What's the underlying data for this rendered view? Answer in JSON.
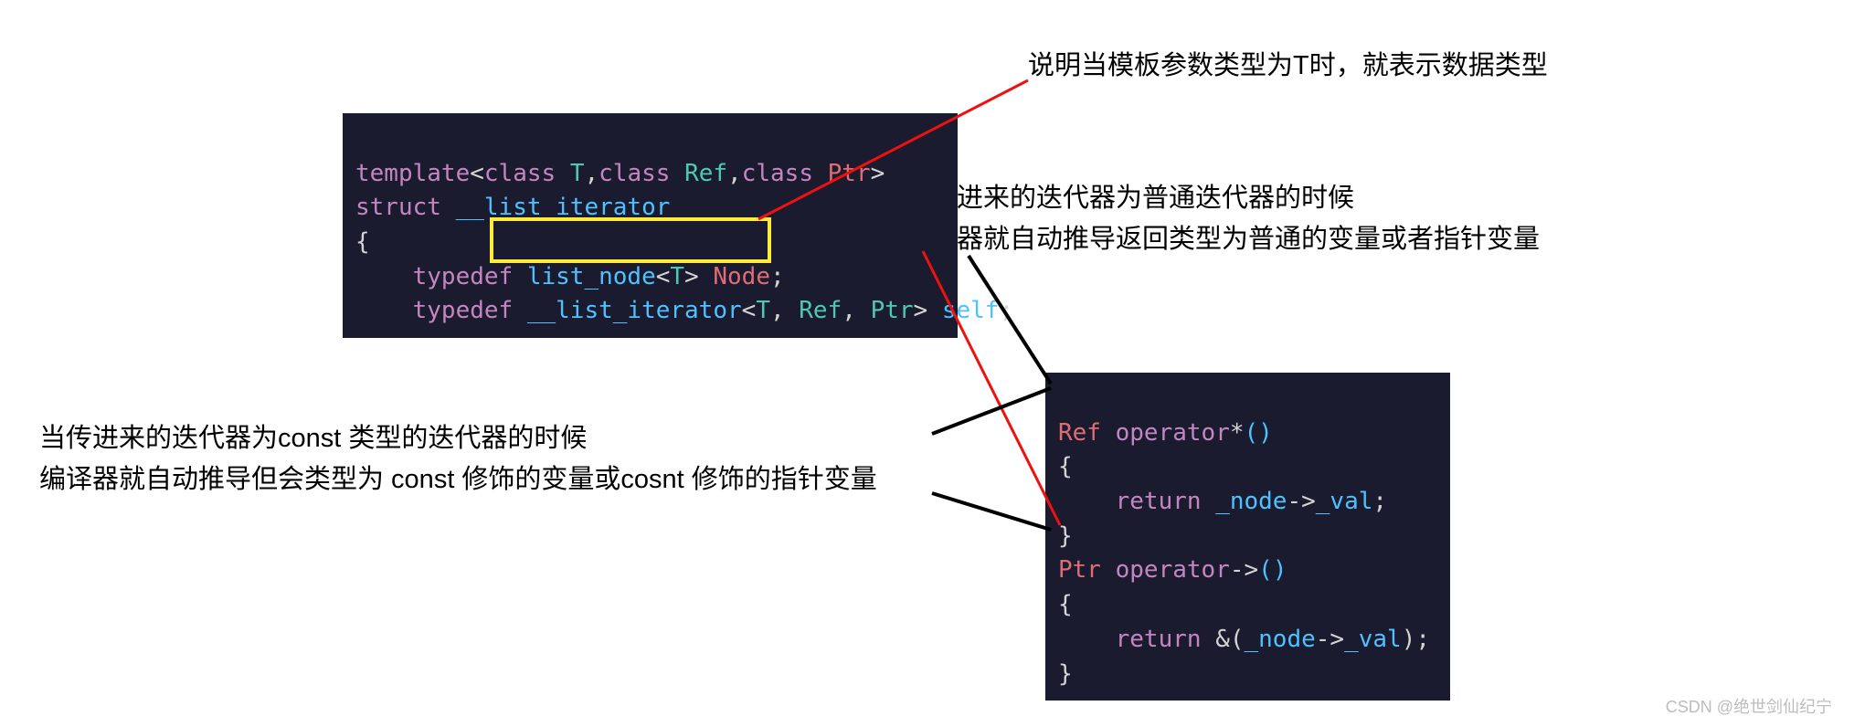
{
  "annotations": {
    "top": "说明当模板参数类型为T时，就表示数据类型",
    "right_1": "当传进来的迭代器为普通迭代器的时候",
    "right_2": "编译器就自动推导返回类型为普通的变量或者指针变量",
    "left_1": "当传进来的迭代器为const 类型的迭代器的时候",
    "left_2": "编译器就自动推导但会类型为 const 修饰的变量或cosnt 修饰的指针变量"
  },
  "code_top": {
    "l1_template": "template",
    "l1_open": "<",
    "l1_class1": "class",
    "l1_T": " T",
    "l1_c1": ",",
    "l1_class2": "class",
    "l1_Ref": " Ref",
    "l1_c2": ",",
    "l1_class3": "class",
    "l1_Ptr": " Ptr",
    "l1_close": ">",
    "l2_struct": "struct ",
    "l2_name": "__list_iterator",
    "l3": "{",
    "l4_td": "    typedef ",
    "l4_ln": "list_node",
    "l4_lt": "<",
    "l4_T": "T",
    "l4_gt": "> ",
    "l4_Node": "Node",
    "l4_semi": ";",
    "l5_td": "    typedef ",
    "l5_li": "__list_iterator",
    "l5_lt": "<",
    "l5_T": "T",
    "l5_c1": ", ",
    "l5_Ref": "Ref",
    "l5_c2": ", ",
    "l5_Ptr": "Ptr",
    "l5_gt": "> ",
    "l5_self": "self",
    "l5_semi": ";"
  },
  "code_bottom": {
    "l1_Ref": "Ref ",
    "l1_op": "operator",
    "l1_star": "*",
    "l1_paren": "()",
    "l2": "{",
    "l3_ret": "    return ",
    "l3_node": "_node",
    "l3_arrow": "->",
    "l3_val": "_val",
    "l3_semi": ";",
    "l4": "}",
    "l5_Ptr": "Ptr ",
    "l5_op": "operator",
    "l5_arrow": "->",
    "l5_paren": "()",
    "l6": "{",
    "l7_ret": "    return ",
    "l7_amp": "&",
    "l7_op1": "(",
    "l7_node": "_node",
    "l7_arrow": "->",
    "l7_val": "_val",
    "l7_op2": ")",
    "l7_semi": ";",
    "l8": "}"
  },
  "watermark": "CSDN @绝世剑仙纪宁"
}
